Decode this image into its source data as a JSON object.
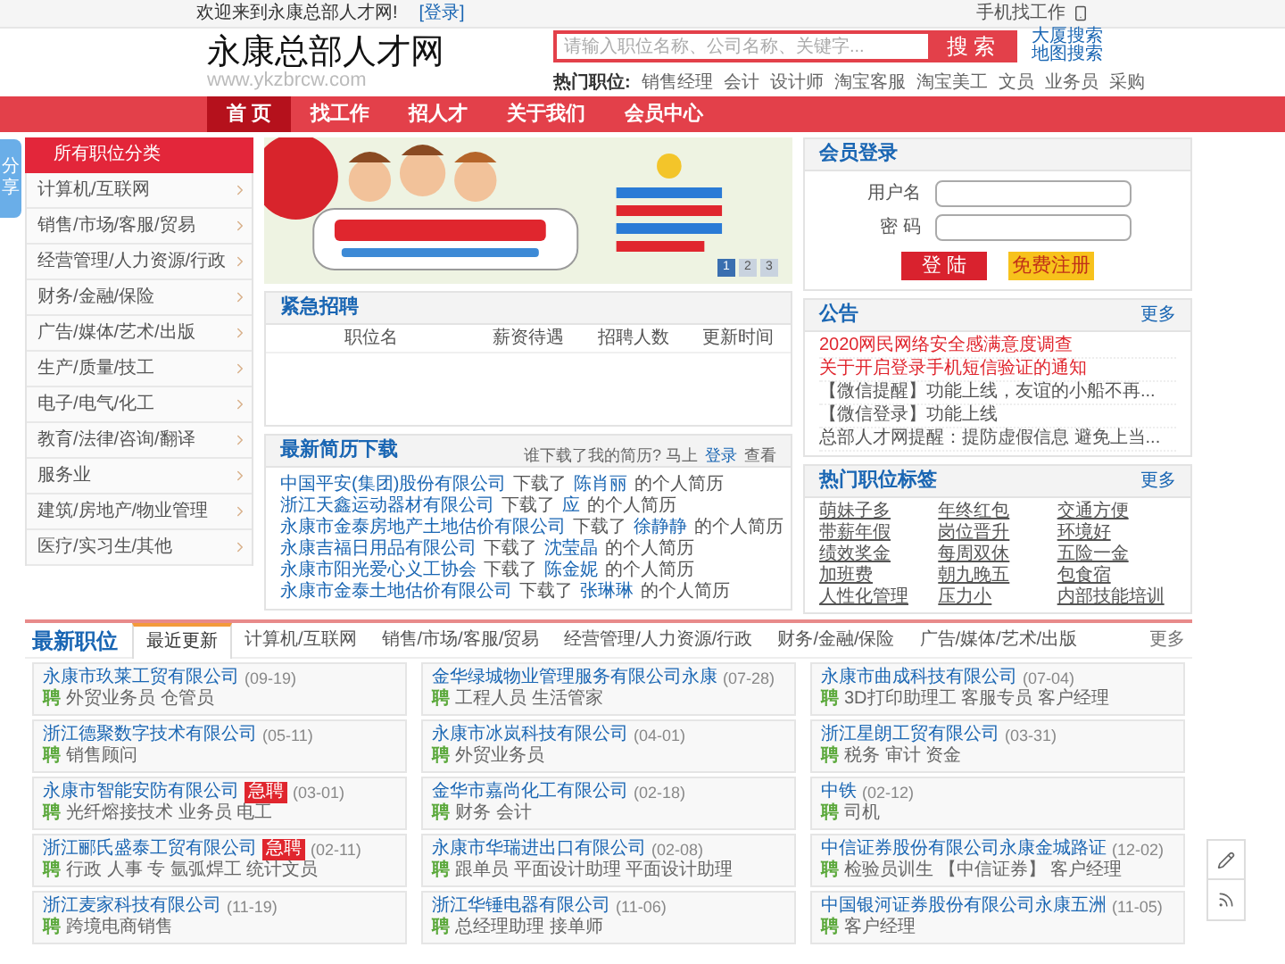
{
  "top_bar": {
    "welcome": "欢迎来到永康总部人才网!",
    "login_link": "[登录]",
    "mobile_link": "手机找工作"
  },
  "header": {
    "logo": "永康总部人才网",
    "url": "www.ykzbrcw.com",
    "search": {
      "placeholder": "请输入职位名称、公司名称、关键字...",
      "button": "搜 索"
    },
    "search_links": [
      "大厦搜索",
      "地图搜索"
    ],
    "hot_label": "热门职位:",
    "hot_jobs": [
      "销售经理",
      "会计",
      "设计师",
      "淘宝客服",
      "淘宝美工",
      "文员",
      "业务员",
      "采购"
    ]
  },
  "nav": [
    {
      "label": "首 页",
      "selected": true
    },
    {
      "label": "找工作",
      "selected": false
    },
    {
      "label": "招人才",
      "selected": false
    },
    {
      "label": "关于我们",
      "selected": false
    },
    {
      "label": "会员中心",
      "selected": false
    }
  ],
  "categories": {
    "title": "所有职位分类",
    "items": [
      "计算机/互联网",
      "销售/市场/客服/贸易",
      "经营管理/人力资源/行政",
      "财务/金融/保险",
      "广告/媒体/艺术/出版",
      "生产/质量/技工",
      "电子/电气/化工",
      "教育/法律/咨询/翻译",
      "服务业",
      "建筑/房地产/物业管理",
      "医疗/实习生/其他"
    ]
  },
  "banner": {
    "kind": "picture",
    "pages": [
      {
        "label": "1",
        "selected": true
      },
      {
        "label": "2",
        "selected": false
      },
      {
        "label": "3",
        "selected": false
      }
    ]
  },
  "urgent": {
    "title": "紧急招聘",
    "columns": [
      "职位名",
      "薪资待遇",
      "招聘人数",
      "更新时间"
    ]
  },
  "resumes": {
    "title": "最新简历下载",
    "prompt": "谁下载了我的简历? 马上",
    "prompt_link": "登录",
    "prompt_end": "查看",
    "items": [
      {
        "company": "中国平安(集团)股份有限公司",
        "verb": "下载了",
        "person": "陈肖丽",
        "suffix": "的个人简历"
      },
      {
        "company": "浙江天鑫运动器材有限公司",
        "verb": "下载了",
        "person": "应",
        "suffix": "的个人简历"
      },
      {
        "company": "永康市金泰房地产土地估价有限公司",
        "verb": "下载了",
        "person": "徐静静",
        "suffix": "的个人简历"
      },
      {
        "company": "永康吉福日用品有限公司",
        "verb": "下载了",
        "person": "沈莹晶",
        "suffix": "的个人简历"
      },
      {
        "company": "永康市阳光爱心义工协会",
        "verb": "下载了",
        "person": "陈金妮",
        "suffix": "的个人简历"
      },
      {
        "company": "永康市金泰土地估价有限公司",
        "verb": "下载了",
        "person": "张琳琳",
        "suffix": "的个人简历"
      }
    ]
  },
  "login": {
    "title": "会员登录",
    "fields": [
      {
        "label": "用户名"
      },
      {
        "label": "密 码"
      }
    ],
    "buttons": [
      {
        "label": "登 陆",
        "kind": "primary"
      },
      {
        "label": "免费注册",
        "kind": "secondary"
      }
    ]
  },
  "notices": {
    "title": "公告",
    "more": "更多",
    "items": [
      {
        "text": "2020网民网络安全感满意度调查",
        "highlight": true
      },
      {
        "text": "关于开启登录手机短信验证的通知",
        "highlight": true
      },
      {
        "text": "【微信提醒】功能上线，友谊的小船不再...",
        "highlight": false
      },
      {
        "text": "【微信登录】功能上线",
        "highlight": false
      },
      {
        "text": "总部人才网提醒：提防虚假信息 避免上当...",
        "highlight": false
      }
    ]
  },
  "tags": {
    "title": "热门职位标签",
    "more": "更多",
    "items": [
      "萌妹子多",
      "年终红包",
      "交通方便",
      "带薪年假",
      "岗位晋升",
      "环境好",
      "绩效奖金",
      "每周双休",
      "五险一金",
      "加班费",
      "朝九晚五",
      "包食宿",
      "人性化管理",
      "压力小",
      "内部技能培训"
    ]
  },
  "latest": {
    "title": "最新职位",
    "tabs": [
      {
        "label": "最近更新",
        "selected": true
      },
      {
        "label": "计算机/互联网",
        "selected": false
      },
      {
        "label": "销售/市场/客服/贸易",
        "selected": false
      },
      {
        "label": "经营管理/人力资源/行政",
        "selected": false
      },
      {
        "label": "财务/金融/保险",
        "selected": false
      },
      {
        "label": "广告/媒体/艺术/出版",
        "selected": false
      }
    ],
    "more": "更多",
    "jobs": [
      {
        "company": "永康市玖莱工贸有限公司",
        "date": "(09-19)",
        "hire_label": "聘",
        "positions": "外贸业务员 仓管员"
      },
      {
        "company": "金华绿城物业管理服务有限公司永康",
        "date": "(07-28)",
        "hire_label": "聘",
        "positions": "工程人员 生活管家"
      },
      {
        "company": "永康市曲成科技有限公司",
        "date": "(07-04)",
        "hire_label": "聘",
        "positions": "3D打印助理工 客服专员 客户经理"
      },
      {
        "company": "浙江德聚数字技术有限公司",
        "date": "(05-11)",
        "hire_label": "聘",
        "positions": "销售顾问"
      },
      {
        "company": "永康市冰岚科技有限公司",
        "date": "(04-01)",
        "hire_label": "聘",
        "positions": "外贸业务员"
      },
      {
        "company": "浙江星朗工贸有限公司",
        "date": "(03-31)",
        "hire_label": "聘",
        "positions": "税务 审计 资金"
      },
      {
        "company": "永康市智能安防有限公司",
        "badge": "急聘",
        "date": "(03-01)",
        "hire_label": "聘",
        "positions": "光纤熔接技术 业务员 电工"
      },
      {
        "company": "金华市嘉尚化工有限公司",
        "date": "(02-18)",
        "hire_label": "聘",
        "positions": "财务 会计"
      },
      {
        "company": "中铁",
        "date": "(02-12)",
        "hire_label": "聘",
        "positions": "司机"
      },
      {
        "company": "浙江郦氏盛泰工贸有限公司",
        "badge": "急聘",
        "date": "(02-11)",
        "hire_label": "聘",
        "positions": "行政 人事 专 氩弧焊工 统计文员"
      },
      {
        "company": "永康市华瑞进出口有限公司",
        "date": "(02-08)",
        "hire_label": "聘",
        "positions": "跟单员 平面设计助理 平面设计助理"
      },
      {
        "company": "中信证券股份有限公司永康金城路证",
        "date": "(12-02)",
        "hire_label": "聘",
        "positions": "检验员训生 【中信证券】 客户经理"
      },
      {
        "company": "浙江麦家科技有限公司",
        "date": "(11-19)",
        "hire_label": "聘",
        "positions": "跨境电商销售"
      },
      {
        "company": "浙江华锤电器有限公司",
        "date": "(11-06)",
        "hire_label": "聘",
        "positions": "总经理助理 接单师"
      },
      {
        "company": "中国银河证券股份有限公司永康五洲",
        "date": "(11-05)",
        "hire_label": "聘",
        "positions": "客户经理"
      }
    ]
  },
  "side": {
    "share": "分享"
  }
}
